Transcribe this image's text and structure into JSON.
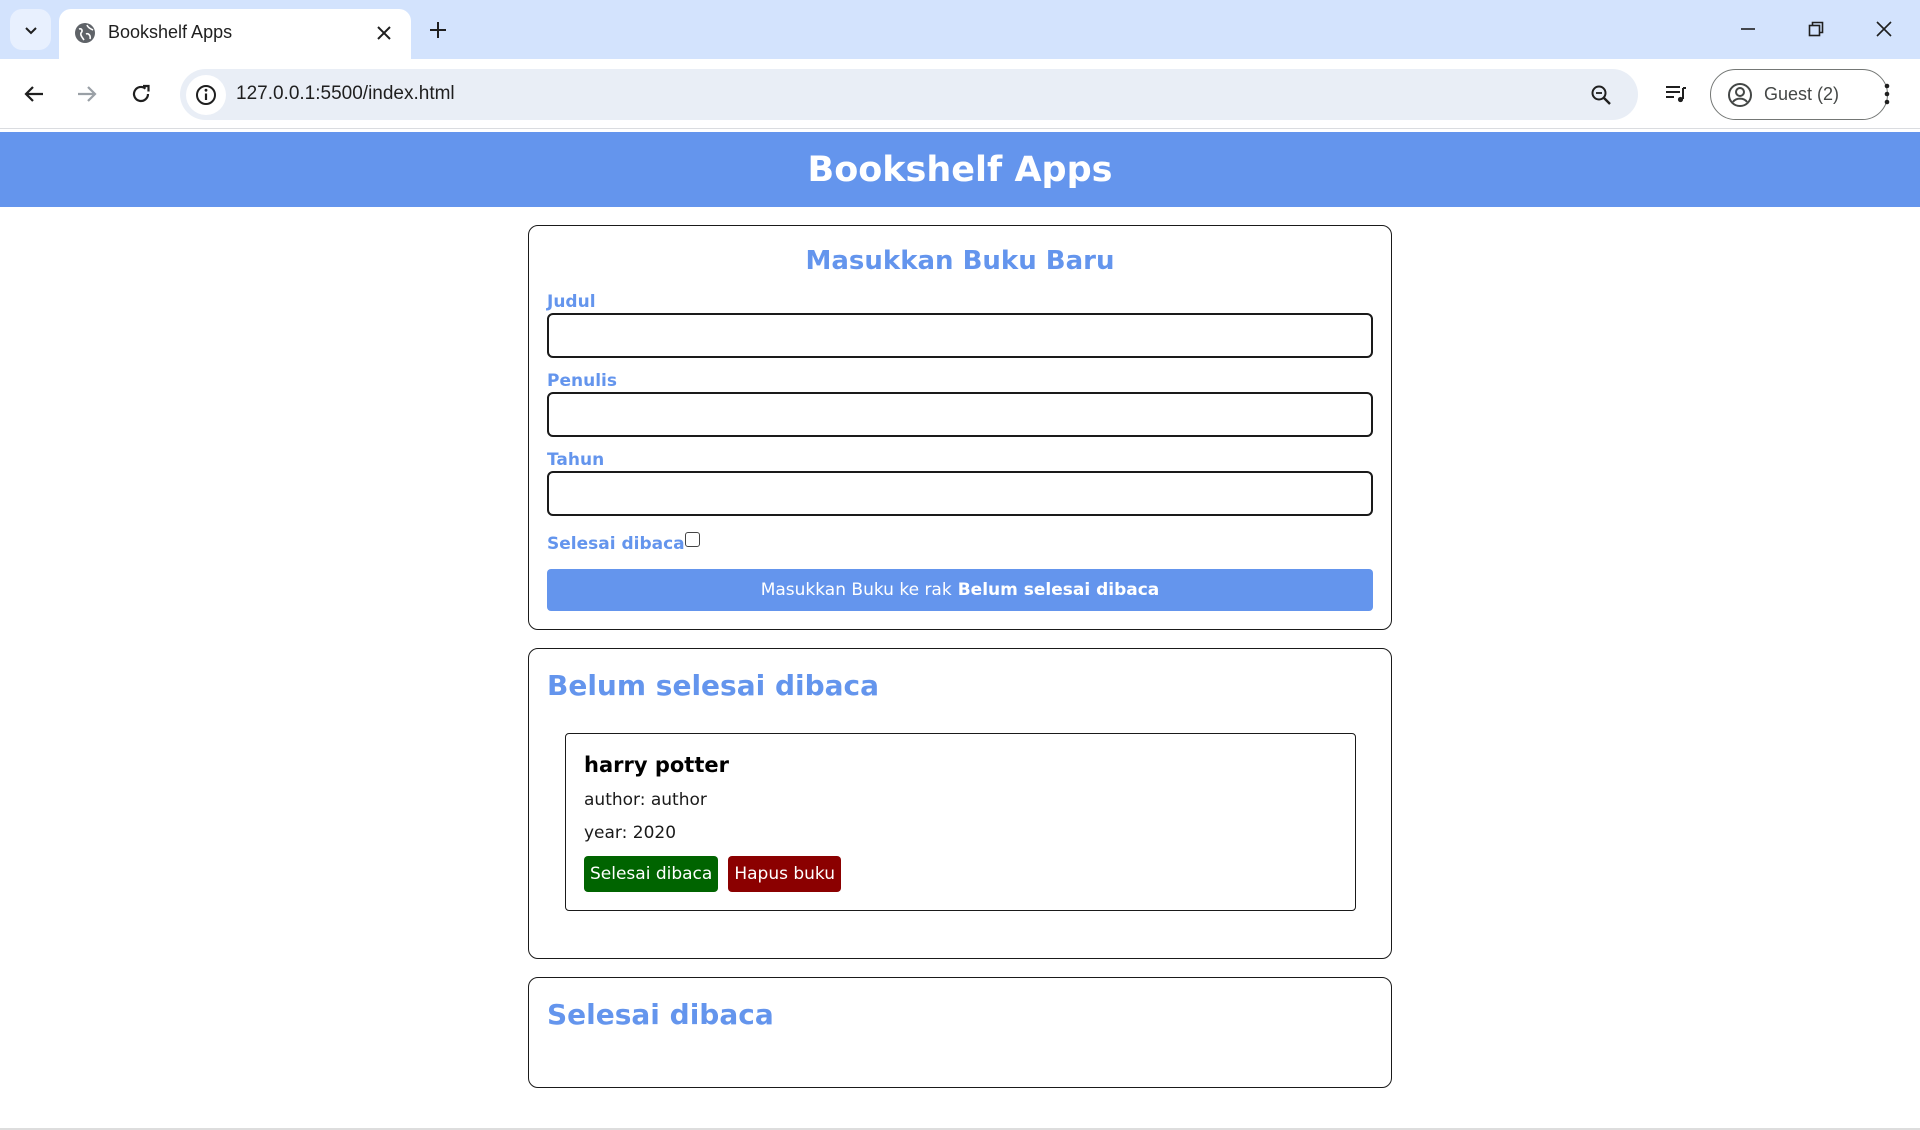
{
  "browser": {
    "tab_title": "Bookshelf Apps",
    "url": "127.0.0.1:5500/index.html",
    "profile_label": "Guest (2)",
    "icons": [
      "tab-search-icon",
      "globe-icon",
      "close-icon",
      "plus-icon",
      "minimize-icon",
      "restore-icon",
      "window-close-icon",
      "back-icon",
      "forward-icon",
      "reload-icon",
      "site-info-icon",
      "zoom-icon",
      "media-control-icon",
      "account-icon",
      "kebab-menu-icon"
    ]
  },
  "header": {
    "title": "Bookshelf Apps"
  },
  "input_form": {
    "title": "Masukkan Buku Baru",
    "title_label": "Judul",
    "title_value": "",
    "author_label": "Penulis",
    "author_value": "",
    "year_label": "Tahun",
    "year_value": "",
    "complete_label": "Selesai dibaca",
    "complete_checked": false,
    "submit_prefix": "Masukkan Buku ke rak",
    "submit_target": "Belum selesai dibaca"
  },
  "incomplete_shelf": {
    "title": "Belum selesai dibaca",
    "books": [
      {
        "title": "harry potter",
        "author": "author: author",
        "year": "year: 2020",
        "done_label": "Selesai dibaca",
        "delete_label": "Hapus buku"
      }
    ]
  },
  "complete_shelf": {
    "title": "Selesai dibaca",
    "books": []
  },
  "colors": {
    "accent": "#6495ed",
    "done_button": "#006400",
    "delete_button": "#8b0000",
    "tabbar": "#d3e3fd"
  }
}
